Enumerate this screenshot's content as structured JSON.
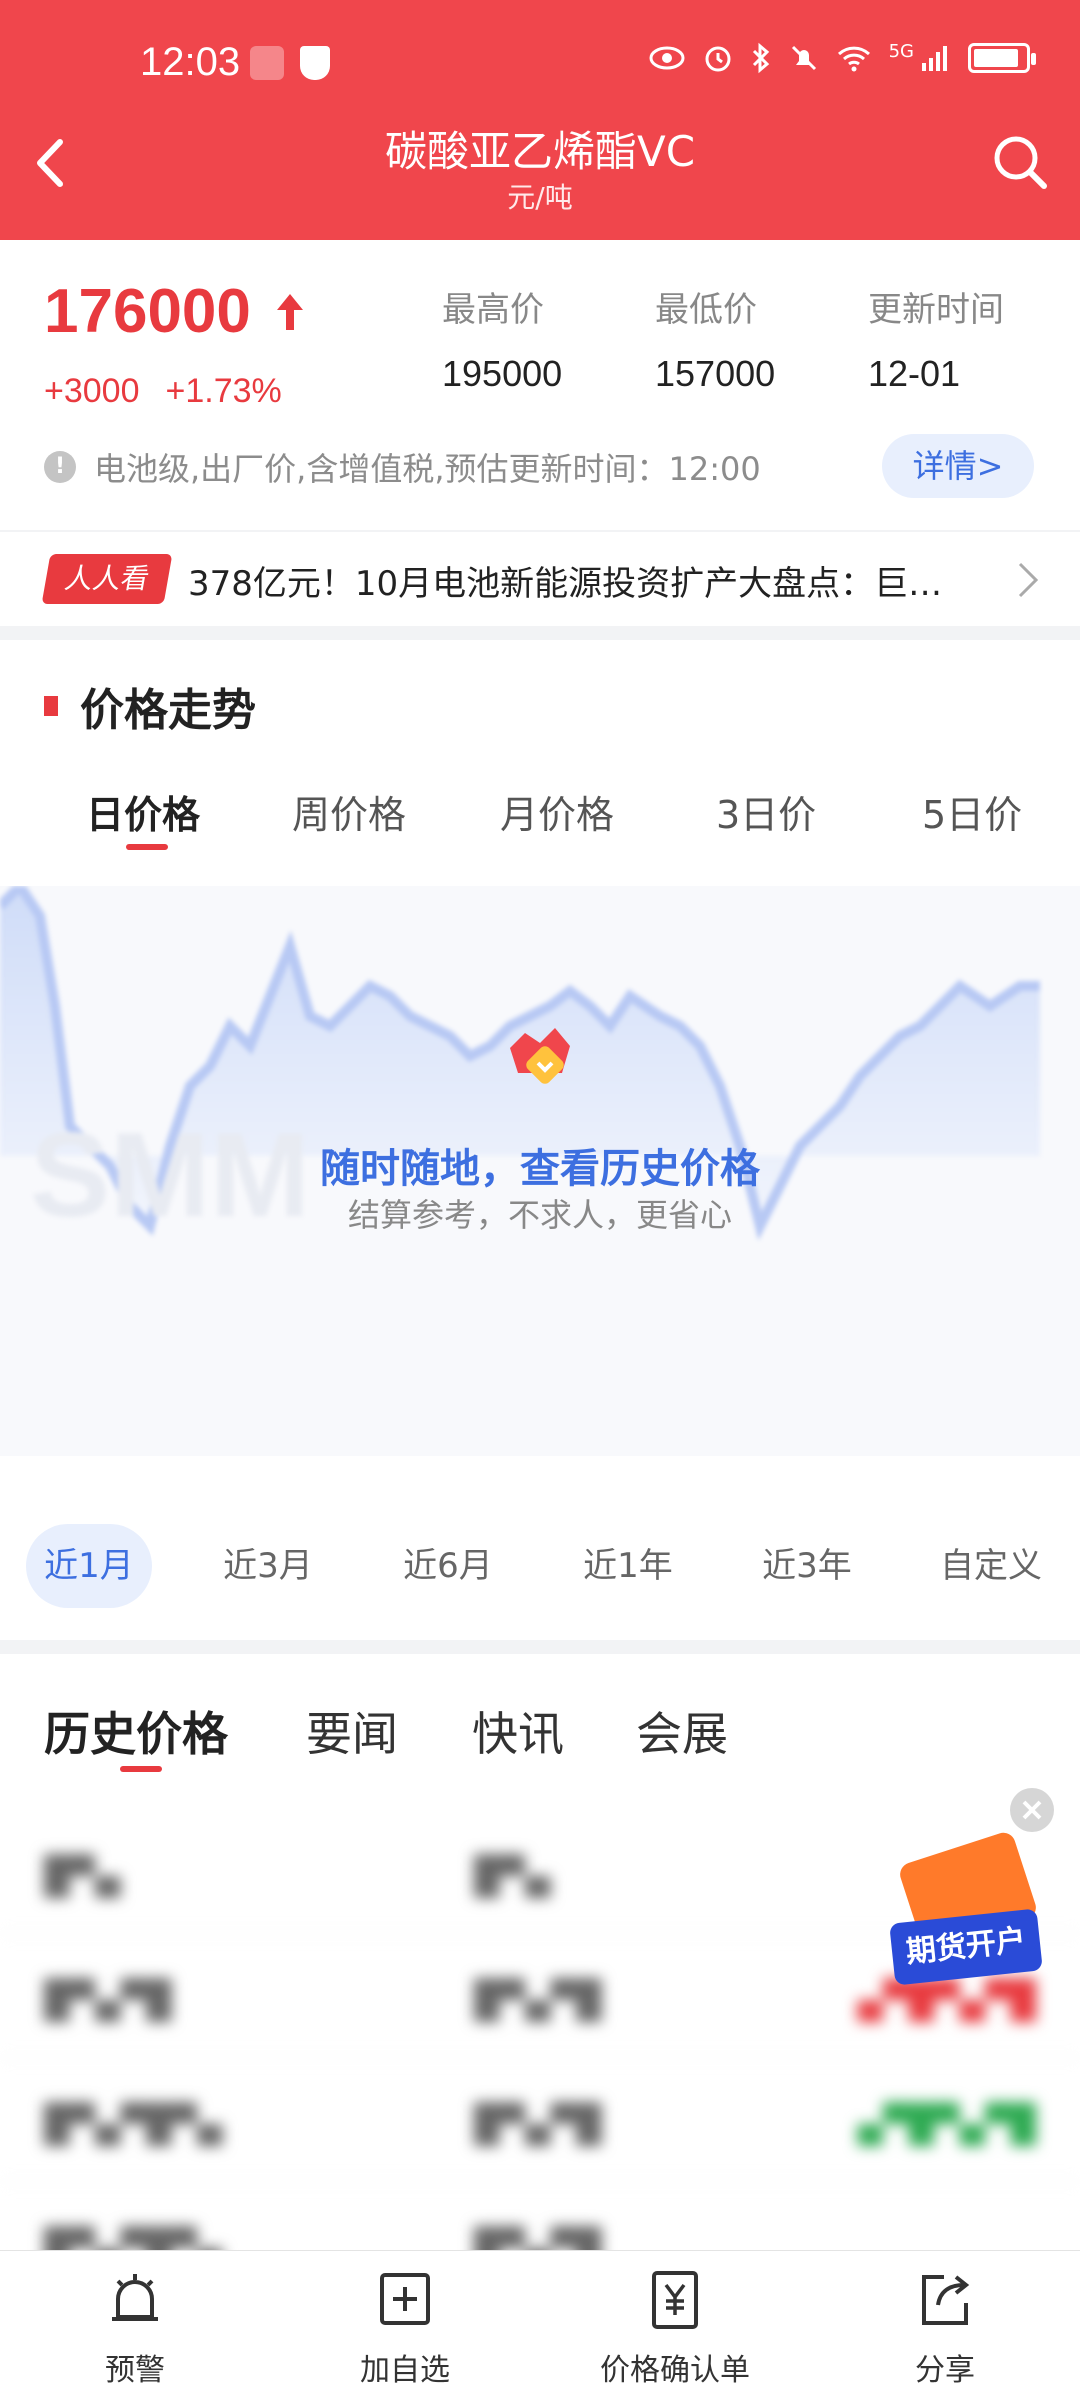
{
  "status": {
    "time": "12:03",
    "network": "5G"
  },
  "header": {
    "title": "碳酸亚乙烯酯VC",
    "unit": "元/吨"
  },
  "price": {
    "current": "176000",
    "change_abs": "+3000",
    "change_pct": "+1.73%",
    "high_label": "最高价",
    "high_value": "195000",
    "low_label": "最低价",
    "low_value": "157000",
    "updated_label": "更新时间",
    "updated_value": "12-01",
    "note": "电池级,出厂价,含增值税,预估更新时间：12:00",
    "detail_label": "详情>"
  },
  "ticker": {
    "tag": "人人看",
    "text": "378亿元！10月电池新能源投资扩产大盘点：巨…"
  },
  "trend": {
    "title": "价格走势",
    "tabs": [
      "日价格",
      "周价格",
      "月价格",
      "3日价",
      "5日价"
    ],
    "active_tab": 0,
    "overlay_title": "随时随地，查看历史价格",
    "overlay_sub": "结算参考，不求人，更省心",
    "watermark": "SMM",
    "ranges": [
      "近1月",
      "近3月",
      "近6月",
      "近1年",
      "近3年",
      "自定义"
    ],
    "active_range": 0
  },
  "info": {
    "tabs": [
      "历史价格",
      "要闻",
      "快讯",
      "会展"
    ],
    "active_tab": 0
  },
  "promo": {
    "label": "期货开户"
  },
  "nav": {
    "items": [
      {
        "label": "预警",
        "icon": "alarm-bell-icon"
      },
      {
        "label": "加自选",
        "icon": "add-favorite-icon"
      },
      {
        "label": "价格确认单",
        "icon": "yen-document-icon"
      },
      {
        "label": "分享",
        "icon": "share-icon"
      }
    ]
  },
  "colors": {
    "header_red": "#f0464c",
    "price_red": "#e83a3f",
    "accent_blue": "#3d6fe0",
    "chart_fill": "#dfe7fb"
  }
}
